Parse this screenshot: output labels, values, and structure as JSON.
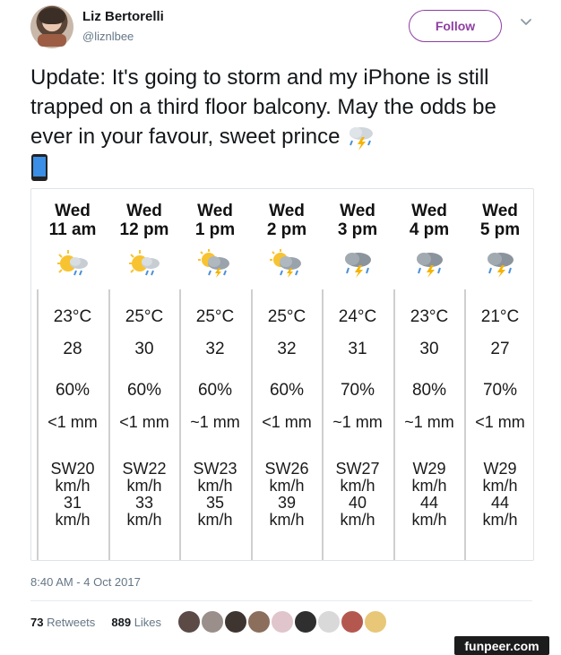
{
  "user": {
    "name": "Liz Bertorelli",
    "handle": "@liznlbee",
    "follow_label": "Follow"
  },
  "tweet": {
    "text": "Update: It's going to storm and my iPhone is still trapped on a third floor balcony. May the odds be ever in your favour, sweet prince",
    "emoji_icons": [
      "cloud-lightning-rain-icon",
      "mobile-phone-icon"
    ]
  },
  "forecast": [
    {
      "day": "Wed",
      "time": "11 am",
      "icon": "sun-rain-icon",
      "temp": "23°C",
      "feels": "28",
      "precip_chance": "60%",
      "rain": "<1 mm",
      "wind_dir_speed": "SW20",
      "wind_unit1": "km/h",
      "gust": "31",
      "wind_unit2": "km/h"
    },
    {
      "day": "Wed",
      "time": "12 pm",
      "icon": "sun-rain-icon",
      "temp": "25°C",
      "feels": "30",
      "precip_chance": "60%",
      "rain": "<1 mm",
      "wind_dir_speed": "SW22",
      "wind_unit1": "km/h",
      "gust": "33",
      "wind_unit2": "km/h"
    },
    {
      "day": "Wed",
      "time": "1 pm",
      "icon": "sun-storm-icon",
      "temp": "25°C",
      "feels": "32",
      "precip_chance": "60%",
      "rain": "~1 mm",
      "wind_dir_speed": "SW23",
      "wind_unit1": "km/h",
      "gust": "35",
      "wind_unit2": "km/h"
    },
    {
      "day": "Wed",
      "time": "2 pm",
      "icon": "sun-storm-icon",
      "temp": "25°C",
      "feels": "32",
      "precip_chance": "60%",
      "rain": "<1 mm",
      "wind_dir_speed": "SW26",
      "wind_unit1": "km/h",
      "gust": "39",
      "wind_unit2": "km/h"
    },
    {
      "day": "Wed",
      "time": "3 pm",
      "icon": "storm-icon",
      "temp": "24°C",
      "feels": "31",
      "precip_chance": "70%",
      "rain": "~1 mm",
      "wind_dir_speed": "SW27",
      "wind_unit1": "km/h",
      "gust": "40",
      "wind_unit2": "km/h"
    },
    {
      "day": "Wed",
      "time": "4 pm",
      "icon": "storm-icon",
      "temp": "23°C",
      "feels": "30",
      "precip_chance": "80%",
      "rain": "~1 mm",
      "wind_dir_speed": "W29",
      "wind_unit1": "km/h",
      "gust": "44",
      "wind_unit2": "km/h"
    },
    {
      "day": "Wed",
      "time": "5 pm",
      "icon": "storm-icon",
      "temp": "21°C",
      "feels": "27",
      "precip_chance": "70%",
      "rain": "<1 mm",
      "wind_dir_speed": "W29",
      "wind_unit1": "km/h",
      "gust": "44",
      "wind_unit2": "km/h"
    }
  ],
  "meta": {
    "timestamp": "8:40 AM - 4 Oct 2017",
    "retweets_count": "73",
    "retweets_label": "Retweets",
    "likes_count": "889",
    "likes_label": "Likes"
  },
  "likers": [
    "#5b4a46",
    "#9a8f8a",
    "#3e3430",
    "#8c6e5d",
    "#e0c5cc",
    "#2f2f2f",
    "#d9d9d9",
    "#b4584f",
    "#e8c778"
  ],
  "watermark": "funpeer.com"
}
